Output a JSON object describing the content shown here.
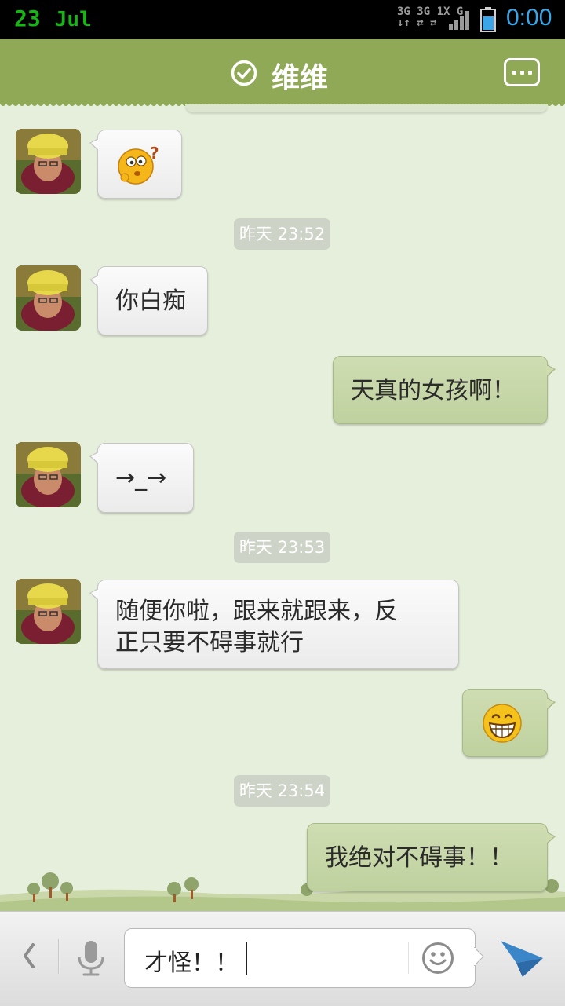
{
  "status_bar": {
    "date_day": "23",
    "date_month": "Jul",
    "network_line1": "3G 3G 1X  G",
    "network_line2": "↓↑ ⇄ ⇄",
    "time": "0:00",
    "colors": {
      "date": "#18b418",
      "time": "#3aa6e8"
    }
  },
  "header": {
    "title": "维维",
    "verified_icon": "check-circle-icon",
    "menu_icon": "chat-menu-icon",
    "color": "#8fa956"
  },
  "messages": [
    {
      "side": "in",
      "type": "emoji",
      "emoji": "confused-question-emoji"
    },
    {
      "type": "timestamp",
      "text": "昨天 23:52"
    },
    {
      "side": "in",
      "type": "text",
      "text": "你白痴"
    },
    {
      "side": "out",
      "type": "text",
      "text": "天真的女孩啊！"
    },
    {
      "side": "in",
      "type": "text",
      "text": "→_→"
    },
    {
      "type": "timestamp",
      "text": "昨天 23:53"
    },
    {
      "side": "in",
      "type": "text",
      "line1": "随便你啦，跟来就跟来，反",
      "line2": "正只要不碍事就行"
    },
    {
      "side": "out",
      "type": "emoji",
      "emoji": "grinning-emoji"
    },
    {
      "type": "timestamp",
      "text": "昨天 23:54"
    },
    {
      "side": "out",
      "type": "text",
      "text": "我绝对不碍事！！"
    }
  ],
  "input_bar": {
    "value": "才怪！！",
    "back_icon": "back-arrow-icon",
    "voice_icon": "microphone-icon",
    "emoji_icon": "smiley-icon",
    "send_icon": "send-icon"
  }
}
